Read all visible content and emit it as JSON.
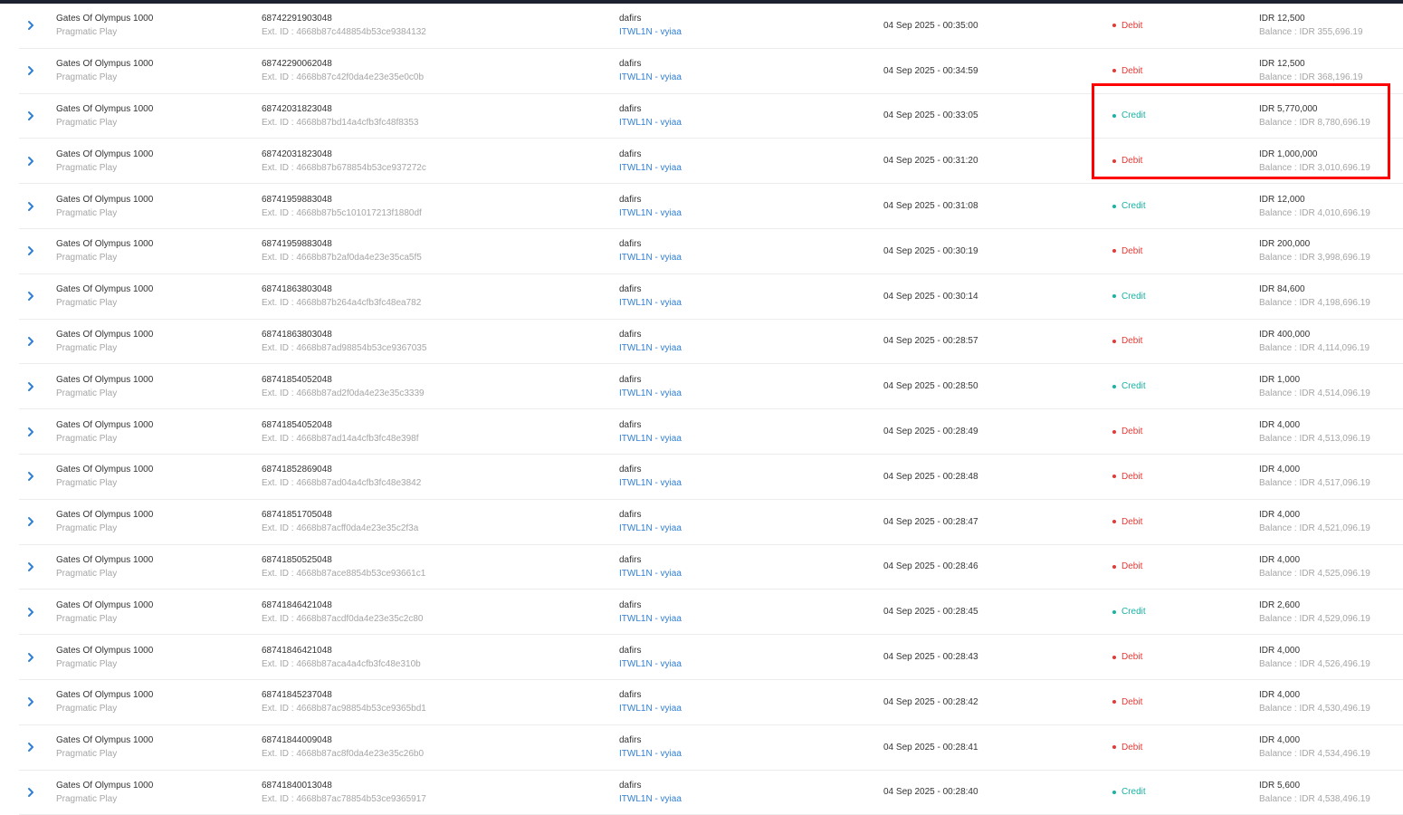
{
  "colors": {
    "debit": "#e53935",
    "credit": "#17b3a3",
    "link": "#2f7fd6",
    "highlight": "#ff0000"
  },
  "icons": {
    "expand": "chevron-right-icon"
  },
  "rows": [
    {
      "game": "Gates Of Olympus 1000",
      "provider": "Pragmatic Play",
      "txn_id": "68742291903048",
      "ext_id": "Ext. ID : 4668b87c448854b53ce9384132",
      "user": "dafirs",
      "agent": "ITWL1N - vyiaa",
      "time": "04 Sep 2025 - 00:35:00",
      "type": "Debit",
      "amount": "IDR 12,500",
      "balance": "Balance : IDR 355,696.19"
    },
    {
      "game": "Gates Of Olympus 1000",
      "provider": "Pragmatic Play",
      "txn_id": "68742290062048",
      "ext_id": "Ext. ID : 4668b87c42f0da4e23e35e0c0b",
      "user": "dafirs",
      "agent": "ITWL1N - vyiaa",
      "time": "04 Sep 2025 - 00:34:59",
      "type": "Debit",
      "amount": "IDR 12,500",
      "balance": "Balance : IDR 368,196.19"
    },
    {
      "game": "Gates Of Olympus 1000",
      "provider": "Pragmatic Play",
      "txn_id": "68742031823048",
      "ext_id": "Ext. ID : 4668b87bd14a4cfb3fc48f8353",
      "user": "dafirs",
      "agent": "ITWL1N - vyiaa",
      "time": "04 Sep 2025 - 00:33:05",
      "type": "Credit",
      "amount": "IDR 5,770,000",
      "balance": "Balance : IDR 8,780,696.19"
    },
    {
      "game": "Gates Of Olympus 1000",
      "provider": "Pragmatic Play",
      "txn_id": "68742031823048",
      "ext_id": "Ext. ID : 4668b87b678854b53ce937272c",
      "user": "dafirs",
      "agent": "ITWL1N - vyiaa",
      "time": "04 Sep 2025 - 00:31:20",
      "type": "Debit",
      "amount": "IDR 1,000,000",
      "balance": "Balance : IDR 3,010,696.19"
    },
    {
      "game": "Gates Of Olympus 1000",
      "provider": "Pragmatic Play",
      "txn_id": "68741959883048",
      "ext_id": "Ext. ID : 4668b87b5c101017213f1880df",
      "user": "dafirs",
      "agent": "ITWL1N - vyiaa",
      "time": "04 Sep 2025 - 00:31:08",
      "type": "Credit",
      "amount": "IDR 12,000",
      "balance": "Balance : IDR 4,010,696.19"
    },
    {
      "game": "Gates Of Olympus 1000",
      "provider": "Pragmatic Play",
      "txn_id": "68741959883048",
      "ext_id": "Ext. ID : 4668b87b2af0da4e23e35ca5f5",
      "user": "dafirs",
      "agent": "ITWL1N - vyiaa",
      "time": "04 Sep 2025 - 00:30:19",
      "type": "Debit",
      "amount": "IDR 200,000",
      "balance": "Balance : IDR 3,998,696.19"
    },
    {
      "game": "Gates Of Olympus 1000",
      "provider": "Pragmatic Play",
      "txn_id": "68741863803048",
      "ext_id": "Ext. ID : 4668b87b264a4cfb3fc48ea782",
      "user": "dafirs",
      "agent": "ITWL1N - vyiaa",
      "time": "04 Sep 2025 - 00:30:14",
      "type": "Credit",
      "amount": "IDR 84,600",
      "balance": "Balance : IDR 4,198,696.19"
    },
    {
      "game": "Gates Of Olympus 1000",
      "provider": "Pragmatic Play",
      "txn_id": "68741863803048",
      "ext_id": "Ext. ID : 4668b87ad98854b53ce9367035",
      "user": "dafirs",
      "agent": "ITWL1N - vyiaa",
      "time": "04 Sep 2025 - 00:28:57",
      "type": "Debit",
      "amount": "IDR 400,000",
      "balance": "Balance : IDR 4,114,096.19"
    },
    {
      "game": "Gates Of Olympus 1000",
      "provider": "Pragmatic Play",
      "txn_id": "68741854052048",
      "ext_id": "Ext. ID : 4668b87ad2f0da4e23e35c3339",
      "user": "dafirs",
      "agent": "ITWL1N - vyiaa",
      "time": "04 Sep 2025 - 00:28:50",
      "type": "Credit",
      "amount": "IDR 1,000",
      "balance": "Balance : IDR 4,514,096.19"
    },
    {
      "game": "Gates Of Olympus 1000",
      "provider": "Pragmatic Play",
      "txn_id": "68741854052048",
      "ext_id": "Ext. ID : 4668b87ad14a4cfb3fc48e398f",
      "user": "dafirs",
      "agent": "ITWL1N - vyiaa",
      "time": "04 Sep 2025 - 00:28:49",
      "type": "Debit",
      "amount": "IDR 4,000",
      "balance": "Balance : IDR 4,513,096.19"
    },
    {
      "game": "Gates Of Olympus 1000",
      "provider": "Pragmatic Play",
      "txn_id": "68741852869048",
      "ext_id": "Ext. ID : 4668b87ad04a4cfb3fc48e3842",
      "user": "dafirs",
      "agent": "ITWL1N - vyiaa",
      "time": "04 Sep 2025 - 00:28:48",
      "type": "Debit",
      "amount": "IDR 4,000",
      "balance": "Balance : IDR 4,517,096.19"
    },
    {
      "game": "Gates Of Olympus 1000",
      "provider": "Pragmatic Play",
      "txn_id": "68741851705048",
      "ext_id": "Ext. ID : 4668b87acff0da4e23e35c2f3a",
      "user": "dafirs",
      "agent": "ITWL1N - vyiaa",
      "time": "04 Sep 2025 - 00:28:47",
      "type": "Debit",
      "amount": "IDR 4,000",
      "balance": "Balance : IDR 4,521,096.19"
    },
    {
      "game": "Gates Of Olympus 1000",
      "provider": "Pragmatic Play",
      "txn_id": "68741850525048",
      "ext_id": "Ext. ID : 4668b87ace8854b53ce93661c1",
      "user": "dafirs",
      "agent": "ITWL1N - vyiaa",
      "time": "04 Sep 2025 - 00:28:46",
      "type": "Debit",
      "amount": "IDR 4,000",
      "balance": "Balance : IDR 4,525,096.19"
    },
    {
      "game": "Gates Of Olympus 1000",
      "provider": "Pragmatic Play",
      "txn_id": "68741846421048",
      "ext_id": "Ext. ID : 4668b87acdf0da4e23e35c2c80",
      "user": "dafirs",
      "agent": "ITWL1N - vyiaa",
      "time": "04 Sep 2025 - 00:28:45",
      "type": "Credit",
      "amount": "IDR 2,600",
      "balance": "Balance : IDR 4,529,096.19"
    },
    {
      "game": "Gates Of Olympus 1000",
      "provider": "Pragmatic Play",
      "txn_id": "68741846421048",
      "ext_id": "Ext. ID : 4668b87aca4a4cfb3fc48e310b",
      "user": "dafirs",
      "agent": "ITWL1N - vyiaa",
      "time": "04 Sep 2025 - 00:28:43",
      "type": "Debit",
      "amount": "IDR 4,000",
      "balance": "Balance : IDR 4,526,496.19"
    },
    {
      "game": "Gates Of Olympus 1000",
      "provider": "Pragmatic Play",
      "txn_id": "68741845237048",
      "ext_id": "Ext. ID : 4668b87ac98854b53ce9365bd1",
      "user": "dafirs",
      "agent": "ITWL1N - vyiaa",
      "time": "04 Sep 2025 - 00:28:42",
      "type": "Debit",
      "amount": "IDR 4,000",
      "balance": "Balance : IDR 4,530,496.19"
    },
    {
      "game": "Gates Of Olympus 1000",
      "provider": "Pragmatic Play",
      "txn_id": "68741844009048",
      "ext_id": "Ext. ID : 4668b87ac8f0da4e23e35c26b0",
      "user": "dafirs",
      "agent": "ITWL1N - vyiaa",
      "time": "04 Sep 2025 - 00:28:41",
      "type": "Debit",
      "amount": "IDR 4,000",
      "balance": "Balance : IDR 4,534,496.19"
    },
    {
      "game": "Gates Of Olympus 1000",
      "provider": "Pragmatic Play",
      "txn_id": "68741840013048",
      "ext_id": "Ext. ID : 4668b87ac78854b53ce9365917",
      "user": "dafirs",
      "agent": "ITWL1N - vyiaa",
      "time": "04 Sep 2025 - 00:28:40",
      "type": "Credit",
      "amount": "IDR 5,600",
      "balance": "Balance : IDR 4,538,496.19"
    }
  ]
}
